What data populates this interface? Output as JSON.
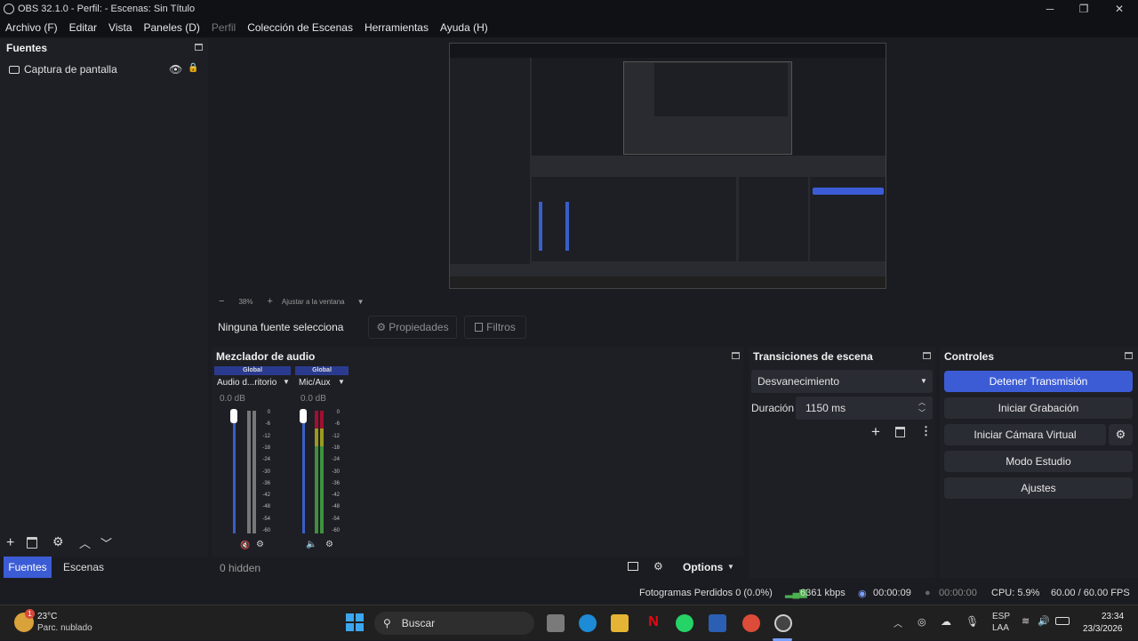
{
  "window": {
    "title": "OBS 32.1.0 - Perfil: - Escenas: Sin Título"
  },
  "menu": [
    "Archivo (F)",
    "Editar",
    "Vista",
    "Paneles (D)",
    "Perfil",
    "Colección de Escenas",
    "Herramientas",
    "Ayuda (H)"
  ],
  "sources": {
    "header": "Fuentes",
    "items": [
      {
        "label": "Captura de pantalla"
      }
    ]
  },
  "bottom_tabs": {
    "fuentes": "Fuentes",
    "escenas": "Escenas"
  },
  "preview": {
    "zoom": "38%",
    "fit": "Ajustar a la ventana"
  },
  "props_bar": {
    "no_source": "Ninguna fuente selecciona",
    "properties": "Propiedades",
    "filters": "Filtros"
  },
  "mixer": {
    "header": "Mezclador de audio",
    "channels": [
      {
        "tag": "Global",
        "name": "Audio d...ritorio",
        "db": "0.0 dB"
      },
      {
        "tag": "Global",
        "name": "Mic/Aux",
        "db": "0.0 dB"
      }
    ],
    "scale": [
      "0",
      "-6",
      "-12",
      "-18",
      "-24",
      "-30",
      "-36",
      "-42",
      "-48",
      "-54",
      "-60"
    ],
    "hidden": "0 hidden",
    "options": "Options"
  },
  "transitions": {
    "header": "Transiciones de escena",
    "selected": "Desvanecimiento",
    "duration_label": "Duración",
    "duration_value": "1150 ms"
  },
  "controls": {
    "header": "Controles",
    "buttons": [
      "Detener Transmisión",
      "Iniciar Grabación",
      "Iniciar Cámara Virtual",
      "Modo Estudio",
      "Ajustes"
    ]
  },
  "status": {
    "dropped": "Fotogramas Perdidos 0 (0.0%)",
    "bitrate": "6361 kbps",
    "stream_time": "00:00:09",
    "rec_time": "00:00:00",
    "cpu": "CPU: 5.9%",
    "fps": "60.00 / 60.00 FPS"
  },
  "taskbar": {
    "weather_temp": "23°C",
    "weather_desc": "Parc. nublado",
    "search": "Buscar",
    "lang1": "ESP",
    "lang2": "LAA",
    "time": "23:34",
    "date": "23/3/2026",
    "badge": "1"
  },
  "colors": {
    "accent": "#3c5cd6",
    "panel": "#1e1f25",
    "bg": "#1b1c21",
    "green": "#4caf50"
  }
}
